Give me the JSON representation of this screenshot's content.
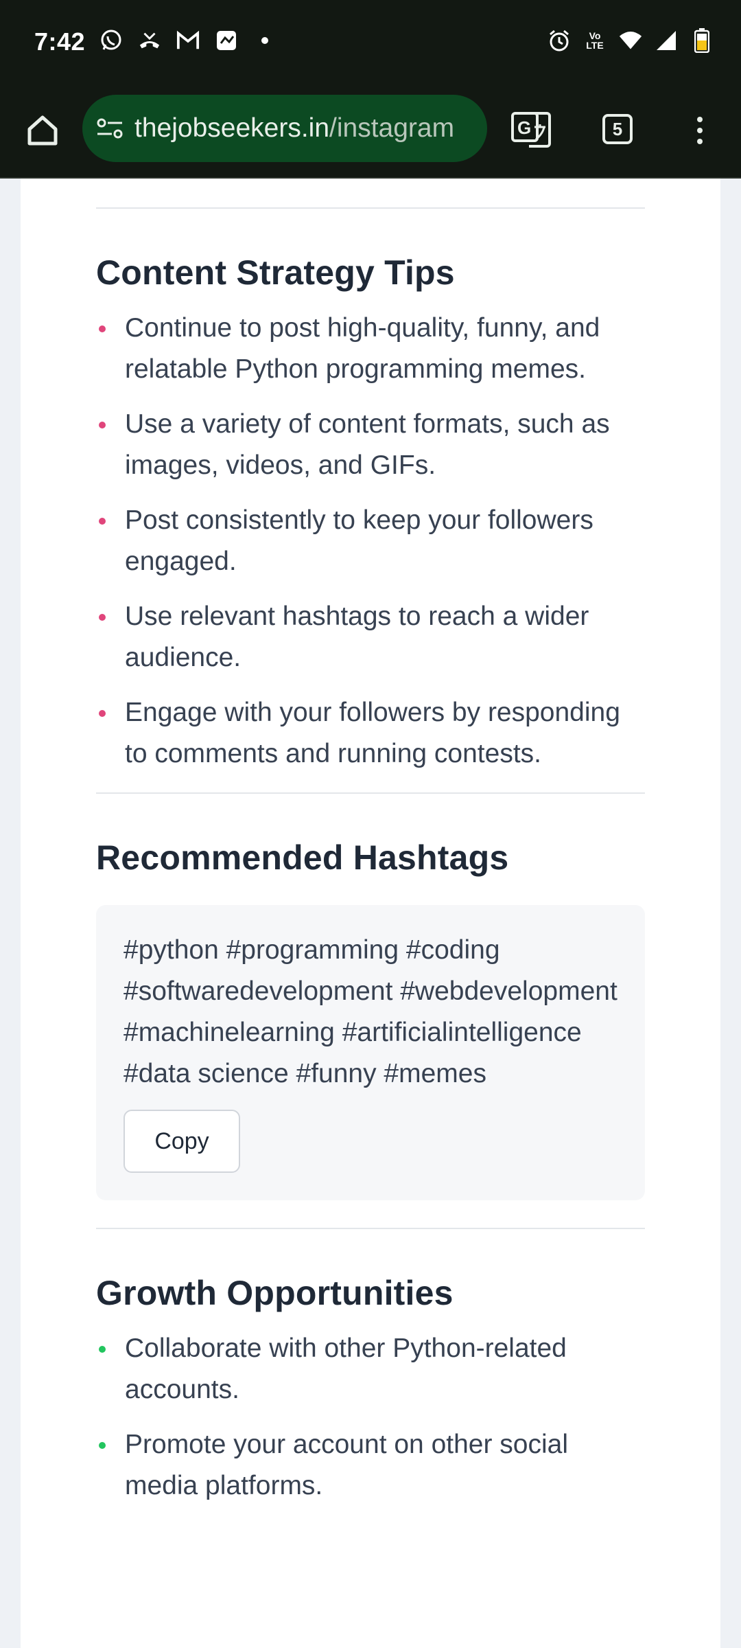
{
  "status_bar": {
    "time": "7:42",
    "left_icons": [
      "whatsapp-icon",
      "missed-call-icon",
      "gmail-icon",
      "photos-icon",
      "dot-icon"
    ],
    "right_icons": [
      "alarm-icon",
      "volte-icon",
      "wifi-icon",
      "signal-icon",
      "battery-icon"
    ],
    "volte_label_top": "Vo",
    "volte_label_bottom": "LTE"
  },
  "browser": {
    "url_domain": "thejobseekers.in",
    "url_path": "/instagram",
    "tab_count": "5"
  },
  "sections": {
    "content_strategy": {
      "title": "Content Strategy Tips",
      "items": [
        "Continue to post high-quality, funny, and relatable Python programming memes.",
        "Use a variety of content formats, such as images, videos, and GIFs.",
        "Post consistently to keep your followers engaged.",
        "Use relevant hashtags to reach a wider audience.",
        "Engage with your followers by responding to comments and running contests."
      ]
    },
    "hashtags": {
      "title": "Recommended Hashtags",
      "text": "#python #programming #coding #softwaredevelopment #webdevelopment #machinelearning #artificialintelligence #data science #funny #memes",
      "copy_label": "Copy"
    },
    "growth": {
      "title": "Growth Opportunities",
      "items": [
        "Collaborate with other Python-related accounts.",
        "Promote your account on other social media platforms."
      ]
    }
  },
  "colors": {
    "bullet_pink": "#e0457b",
    "bullet_green": "#22c55e",
    "url_bar_bg": "#0c4a22",
    "chrome_bg": "#121812"
  }
}
